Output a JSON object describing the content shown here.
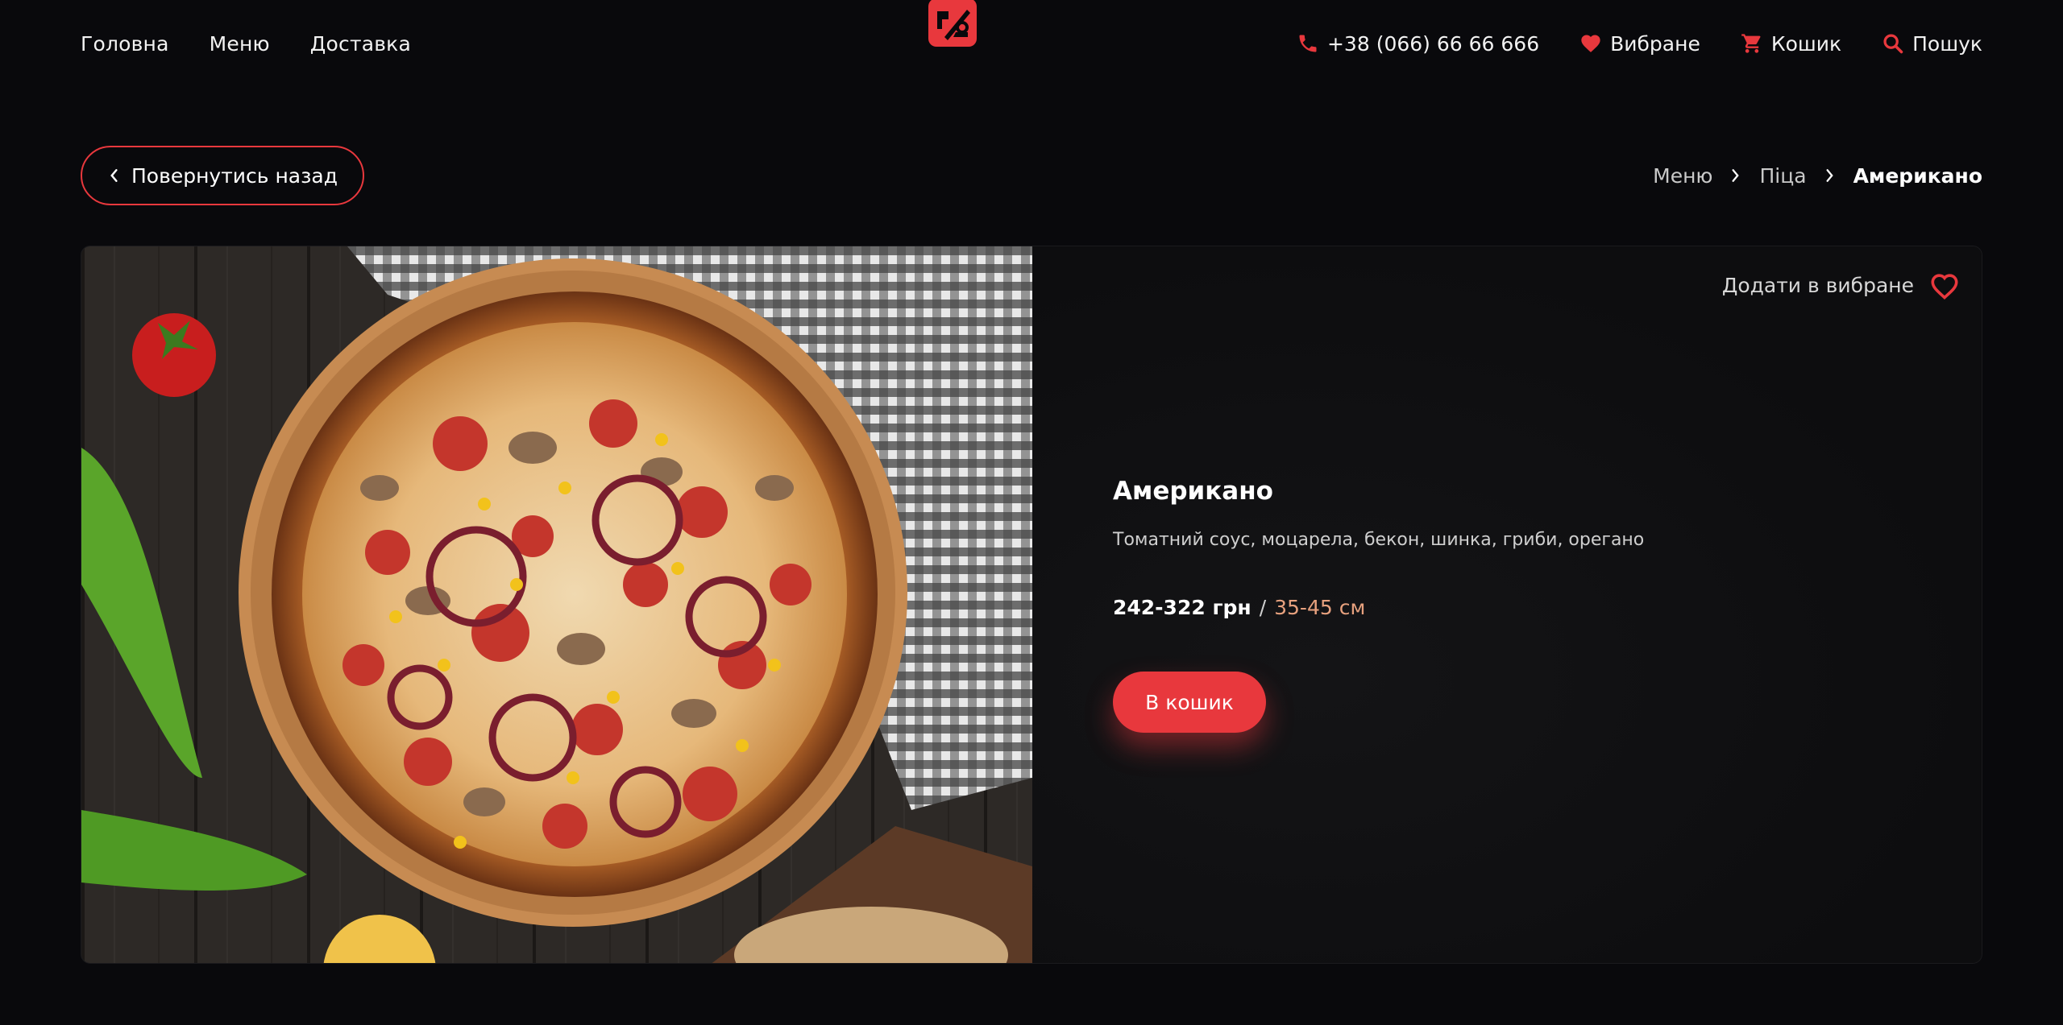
{
  "header": {
    "nav": [
      "Головна",
      "Меню",
      "Доставка"
    ],
    "phone": "+38 (066) 66 66 666",
    "favorites": "Вибране",
    "cart": "Кошик",
    "search": "Пошук"
  },
  "back_button": "Повернутись назад",
  "breadcrumb": [
    "Меню",
    "Піца",
    "Американо"
  ],
  "product": {
    "add_favorite": "Додати в вибране",
    "name": "Американо",
    "description": "Томатний соус, моцарела, бекон, шинка, гриби, орегано",
    "price": "242-322 грн",
    "separator": "/",
    "size": "35-45 см",
    "cart_button": "В кошик"
  },
  "colors": {
    "accent": "#e8383d",
    "background": "#09090c",
    "size_text": "#e7a17e"
  },
  "icons": [
    "phone-icon",
    "heart-icon",
    "cart-icon",
    "search-icon",
    "chevron-left-icon",
    "chevron-right-icon",
    "heart-outline-icon"
  ]
}
